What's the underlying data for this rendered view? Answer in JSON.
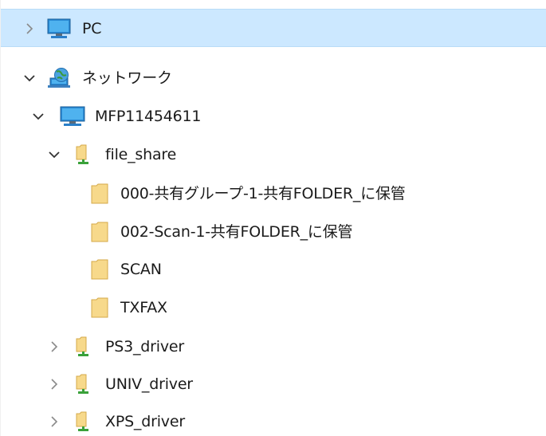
{
  "tree": {
    "pc": {
      "label": "PC",
      "state": "collapsed",
      "selected": true,
      "icon": "pc-monitor-icon"
    },
    "network": {
      "label": "ネットワーク",
      "state": "expanded",
      "icon": "network-globe-icon"
    },
    "device": {
      "label": "MFP11454611",
      "state": "expanded",
      "icon": "computer-monitor-icon"
    },
    "file_share": {
      "label": "file_share",
      "state": "expanded",
      "icon": "shared-folder-icon"
    },
    "folders": [
      {
        "label": "000-共有グループ-1-共有FOLDER_に保管",
        "icon": "folder-icon"
      },
      {
        "label": "002-Scan-1-共有FOLDER_に保管",
        "icon": "folder-icon"
      },
      {
        "label": "SCAN",
        "icon": "folder-icon"
      },
      {
        "label": "TXFAX",
        "icon": "folder-icon"
      }
    ],
    "shares": [
      {
        "label": "PS3_driver",
        "state": "collapsed",
        "icon": "shared-folder-icon"
      },
      {
        "label": "UNIV_driver",
        "state": "collapsed",
        "icon": "shared-folder-icon"
      },
      {
        "label": "XPS_driver",
        "state": "collapsed",
        "icon": "shared-folder-icon"
      }
    ]
  },
  "colors": {
    "selection": "#cce8ff",
    "folder": "#f7d98b",
    "monitor": "#2a8ad4",
    "share_base": "#3aa13a"
  }
}
